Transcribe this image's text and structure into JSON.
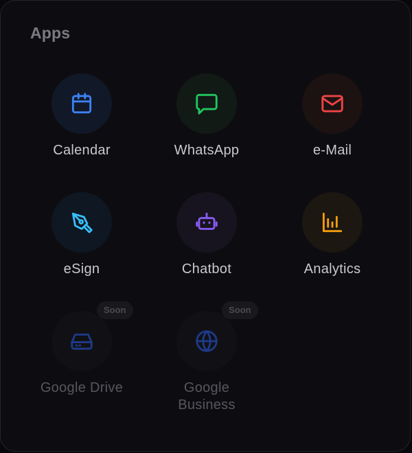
{
  "panel": {
    "title": "Apps"
  },
  "apps": [
    {
      "label": "Calendar",
      "icon": "calendar-icon",
      "color": "#3b82f6",
      "bg": "#111827",
      "status": "available"
    },
    {
      "label": "WhatsApp",
      "icon": "chat-bubble-icon",
      "color": "#22c55e",
      "bg": "#111a15",
      "status": "available"
    },
    {
      "label": "e-Mail",
      "icon": "mail-icon",
      "color": "#ef4444",
      "bg": "#1c1212",
      "status": "available"
    },
    {
      "label": "eSign",
      "icon": "pen-nib-icon",
      "color": "#38bdf8",
      "bg": "#0f1722",
      "status": "available"
    },
    {
      "label": "Chatbot",
      "icon": "robot-icon",
      "color": "#8b5cf6",
      "bg": "#17141f",
      "status": "available"
    },
    {
      "label": "Analytics",
      "icon": "bar-chart-icon",
      "color": "#f59e0b",
      "bg": "#1c1710",
      "status": "available"
    },
    {
      "label": "Google Drive",
      "icon": "hard-drive-icon",
      "color": "#1e3a8a",
      "bg": "#111115",
      "status": "soon",
      "badge": "Soon"
    },
    {
      "label": "Google Business",
      "label_line1": "Google",
      "label_line2": "Business",
      "icon": "globe-icon",
      "color": "#1e3a8a",
      "bg": "#111115",
      "status": "soon",
      "badge": "Soon"
    }
  ]
}
